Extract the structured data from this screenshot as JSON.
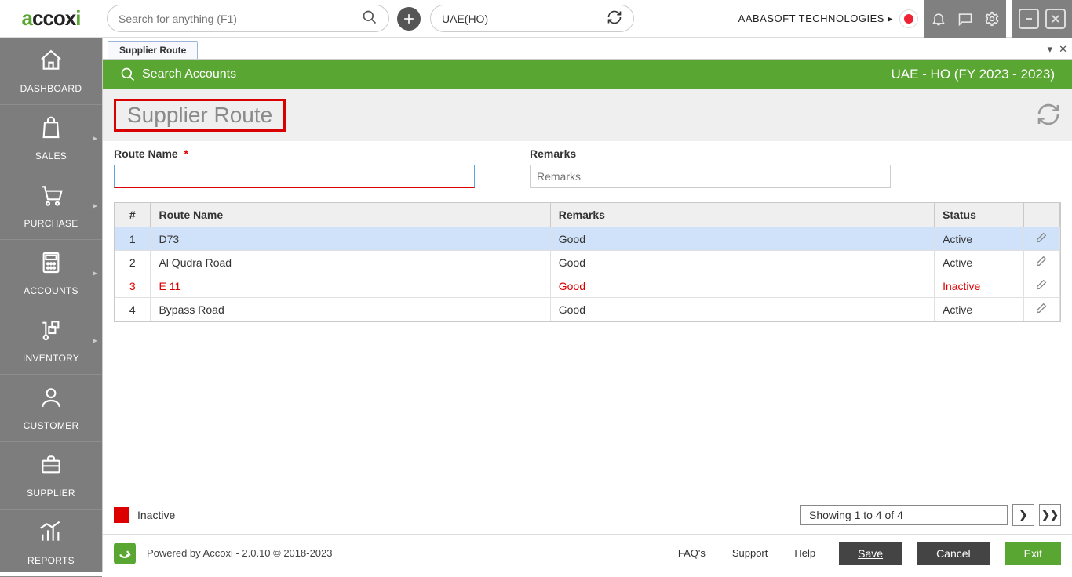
{
  "topbar": {
    "search_placeholder": "Search for anything (F1)",
    "context": "UAE(HO)",
    "company": "AABASOFT TECHNOLOGIES"
  },
  "sidebar": {
    "items": [
      {
        "label": "DASHBOARD"
      },
      {
        "label": "SALES"
      },
      {
        "label": "PURCHASE"
      },
      {
        "label": "ACCOUNTS"
      },
      {
        "label": "INVENTORY"
      },
      {
        "label": "CUSTOMER"
      },
      {
        "label": "SUPPLIER"
      },
      {
        "label": "REPORTS"
      }
    ]
  },
  "tabs": {
    "active": "Supplier Route"
  },
  "greenbar": {
    "search_label": "Search Accounts",
    "fy": "UAE - HO (FY 2023 - 2023)"
  },
  "page": {
    "title": "Supplier Route",
    "route_label": "Route Name",
    "remarks_label": "Remarks",
    "remarks_placeholder": "Remarks"
  },
  "table": {
    "headers": {
      "num": "#",
      "route": "Route Name",
      "remarks": "Remarks",
      "status": "Status"
    },
    "rows": [
      {
        "num": "1",
        "route": "D73",
        "remarks": "Good",
        "status": "Active",
        "selected": true,
        "inactive": false
      },
      {
        "num": "2",
        "route": "Al Qudra Road",
        "remarks": "Good",
        "status": "Active",
        "selected": false,
        "inactive": false
      },
      {
        "num": "3",
        "route": "E 11",
        "remarks": "Good",
        "status": "Inactive",
        "selected": false,
        "inactive": true
      },
      {
        "num": "4",
        "route": "Bypass Road",
        "remarks": "Good",
        "status": "Active",
        "selected": false,
        "inactive": false
      }
    ]
  },
  "legend": {
    "inactive": "Inactive"
  },
  "pagination": {
    "text": "Showing 1 to 4 of 4"
  },
  "footer": {
    "powered": "Powered by Accoxi - 2.0.10 © 2018-2023",
    "faqs": "FAQ's",
    "support": "Support",
    "help": "Help",
    "save": "Save",
    "cancel": "Cancel",
    "exit": "Exit"
  }
}
